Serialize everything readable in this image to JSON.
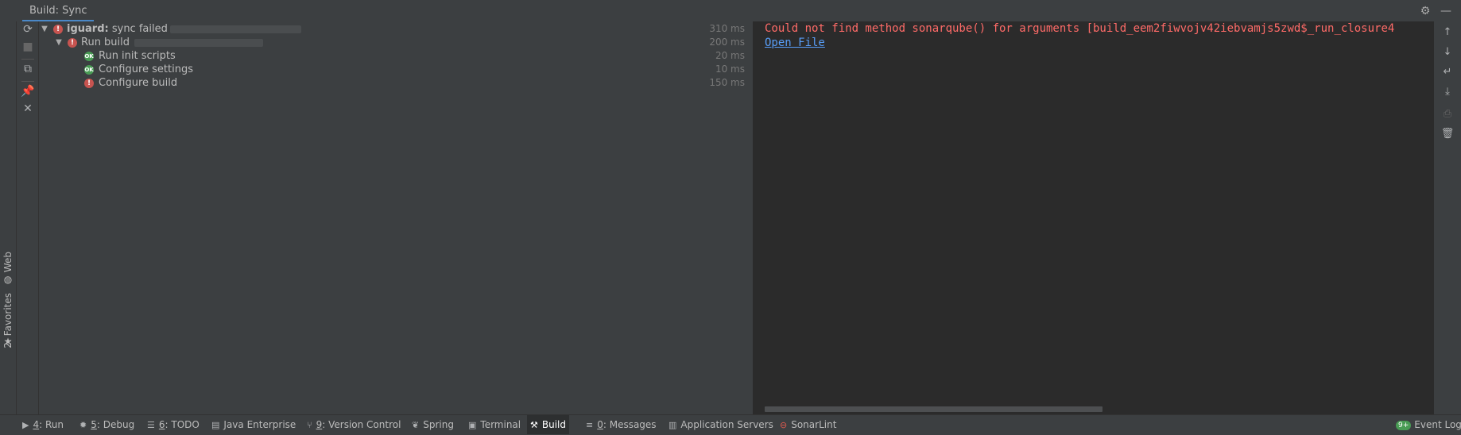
{
  "titlebar": {
    "tab_label": "Build: Sync",
    "icons": [
      "gear-icon",
      "minimize-icon"
    ]
  },
  "left_stripe": {
    "web_label": "Web",
    "favorites_label": "2: Favorites"
  },
  "left_toolbar": {
    "buttons": [
      "sync-icon",
      "stop-icon",
      "copy-icon",
      "pin-icon",
      "close-icon"
    ]
  },
  "tree": {
    "rows": [
      {
        "project": "iguard:",
        "label": " sync failed",
        "status": "error",
        "duration": "310 ms",
        "expanded": true
      },
      {
        "label": "Run build",
        "status": "error",
        "duration": "200 ms",
        "expanded": true
      },
      {
        "label": "Run init scripts",
        "status": "ok",
        "duration": "20 ms"
      },
      {
        "label": "Configure settings",
        "status": "ok",
        "duration": "10 ms"
      },
      {
        "label": "Configure build",
        "status": "error",
        "duration": "150 ms"
      }
    ],
    "ok_glyph": "OK",
    "error_glyph": "!"
  },
  "console": {
    "error_line": "Could not find method sonarqube() for arguments [build_eem2fiwvojv42iebvamjs5zwd$_run_closure4",
    "link": "Open File"
  },
  "right_toolbar": {
    "buttons": [
      "up-arrow-icon",
      "down-arrow-icon",
      "soft-wrap-icon",
      "scroll-to-end-icon",
      "print-icon",
      "trash-icon"
    ]
  },
  "statusbar": {
    "tabs": [
      {
        "key": "4",
        "label": ": Run",
        "icon": "run-icon"
      },
      {
        "key": "5",
        "label": ": Debug",
        "icon": "debug-icon"
      },
      {
        "key": "6",
        "label": ": TODO",
        "icon": "todo-icon"
      },
      {
        "key": "",
        "label": "Java Enterprise",
        "icon": "java-enterprise-icon"
      },
      {
        "key": "9",
        "label": ": Version Control",
        "icon": "version-control-icon"
      },
      {
        "key": "",
        "label": "Spring",
        "icon": "spring-icon"
      },
      {
        "key": "",
        "label": "Terminal",
        "icon": "terminal-icon"
      },
      {
        "key": "",
        "label": "Build",
        "icon": "hammer-icon",
        "active": true
      },
      {
        "key": "0",
        "label": ": Messages",
        "icon": "messages-icon"
      },
      {
        "key": "",
        "label": "Application Servers",
        "icon": "app-servers-icon"
      },
      {
        "key": "",
        "label": "SonarLint",
        "icon": "sonarlint-icon"
      }
    ],
    "event_log_badge": "9+",
    "event_log_label": "Event Log"
  }
}
